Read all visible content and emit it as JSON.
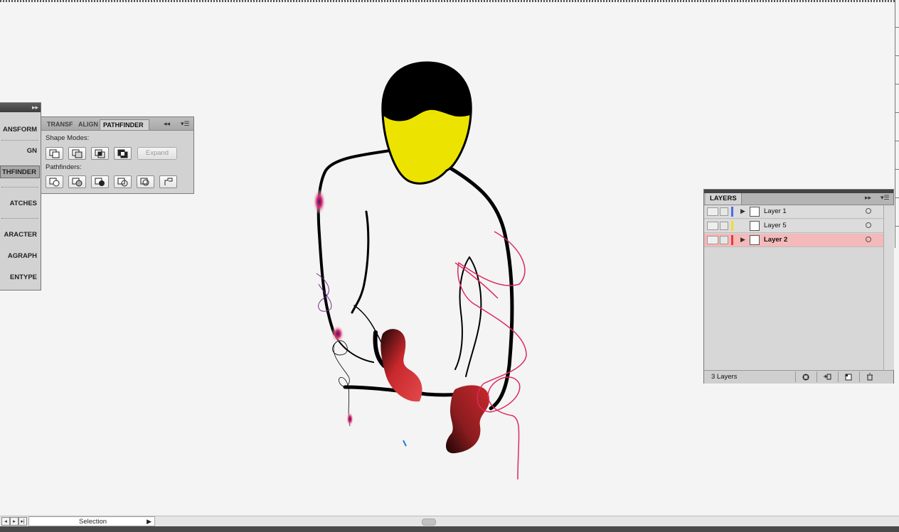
{
  "dock": {
    "items": [
      {
        "label": "ANSFORM"
      },
      {
        "label": "GN"
      },
      {
        "label": "THFINDER"
      },
      {
        "label": "ATCHES"
      },
      {
        "label": "ARACTER"
      },
      {
        "label": "AGRAPH"
      },
      {
        "label": "ENTYPE"
      }
    ],
    "collapse_icon": "double-chevron-right-icon"
  },
  "pathfinder": {
    "tabs": [
      {
        "label": "TRANSF"
      },
      {
        "label": "ALIGN"
      },
      {
        "label": "PATHFINDER"
      }
    ],
    "shape_modes_label": "Shape Modes:",
    "pathfinders_label": "Pathfinders:",
    "expand_label": "Expand",
    "shape_mode_buttons": [
      "unite-icon",
      "minus-front-icon",
      "intersect-icon",
      "exclude-icon"
    ],
    "pathfinder_buttons": [
      "divide-icon",
      "trim-icon",
      "merge-icon",
      "crop-icon",
      "outline-icon",
      "minus-back-icon"
    ]
  },
  "layers": {
    "tab_label": "LAYERS",
    "rows": [
      {
        "name": "Layer 1",
        "color": "#4a6ce8"
      },
      {
        "name": "Layer 5",
        "color": "#f0e020"
      },
      {
        "name": "Layer 2",
        "color": "#e83a3a"
      }
    ],
    "footer_count": "3 Layers"
  },
  "status": {
    "mode_label": "Selection"
  },
  "colors": {
    "face_yellow": "#ece400",
    "accent_red": "#c8282c",
    "stroke_pink": "#dc2a5e"
  }
}
